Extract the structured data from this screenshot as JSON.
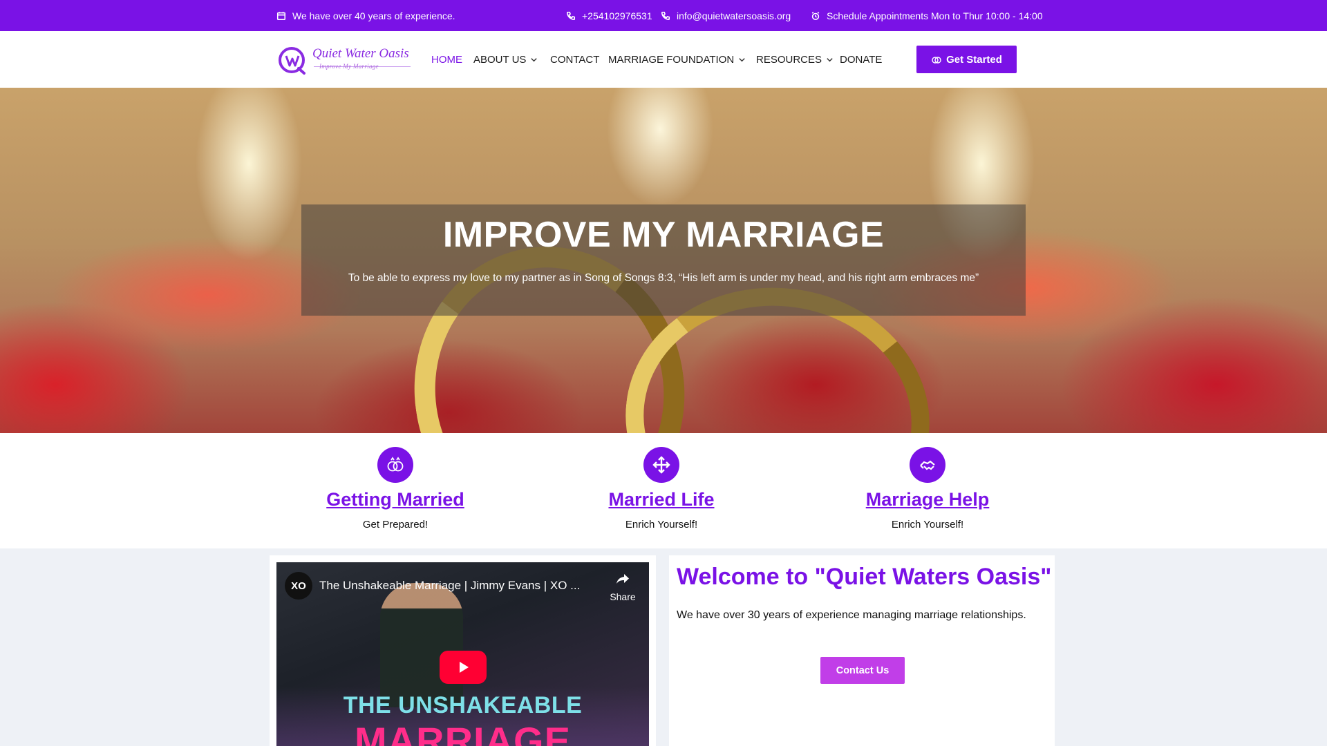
{
  "topbar": {
    "experience": "We have over 40 years of experience.",
    "phone": "+254102976531",
    "email": "info@quietwatersoasis.org",
    "schedule": "Schedule Appointments Mon to Thur 10:00 - 14:00",
    "background_color": "#7a12e6"
  },
  "logo": {
    "name": "Quiet Water Oasis",
    "tagline": "Improve My Marriage"
  },
  "nav": {
    "items": [
      {
        "label": "HOME",
        "active": true,
        "has_dropdown": false
      },
      {
        "label": "ABOUT US",
        "active": false,
        "has_dropdown": true
      },
      {
        "label": "CONTACT",
        "active": false,
        "has_dropdown": false
      },
      {
        "label": "MARRIAGE FOUNDATION",
        "active": false,
        "has_dropdown": true
      },
      {
        "label": "RESOURCES",
        "active": false,
        "has_dropdown": true
      },
      {
        "label": "DONATE",
        "active": false,
        "has_dropdown": false
      }
    ],
    "cta_label": "Get Started",
    "accent_color": "#7a12e6"
  },
  "hero": {
    "title": "IMPROVE MY MARRIAGE",
    "text": "To be able to express my love to my partner as in Song of Songs 8:3, “His left arm is under my head, and his right arm embraces me”"
  },
  "features": [
    {
      "icon": "rings-icon",
      "title": "Getting Married",
      "subtitle": "Get Prepared!"
    },
    {
      "icon": "move-arrows-icon",
      "title": "Married Life",
      "subtitle": "Enrich Yourself!"
    },
    {
      "icon": "handshake-icon",
      "title": "Marriage Help",
      "subtitle": "Enrich Yourself!"
    }
  ],
  "video": {
    "channel_badge": "XO",
    "title": "The Unshakeable Marriage | Jimmy Evans | XO ...",
    "share_label": "Share",
    "thumbnail_line1": "THE UNSHAKEABLE",
    "thumbnail_line2": "MARRIAGE"
  },
  "welcome": {
    "title": "Welcome to \"Quiet Waters Oasis\"",
    "text": "We have over 30 years of experience managing marriage relationships.",
    "button_label": "Contact Us",
    "button_color": "#c13ee8"
  }
}
